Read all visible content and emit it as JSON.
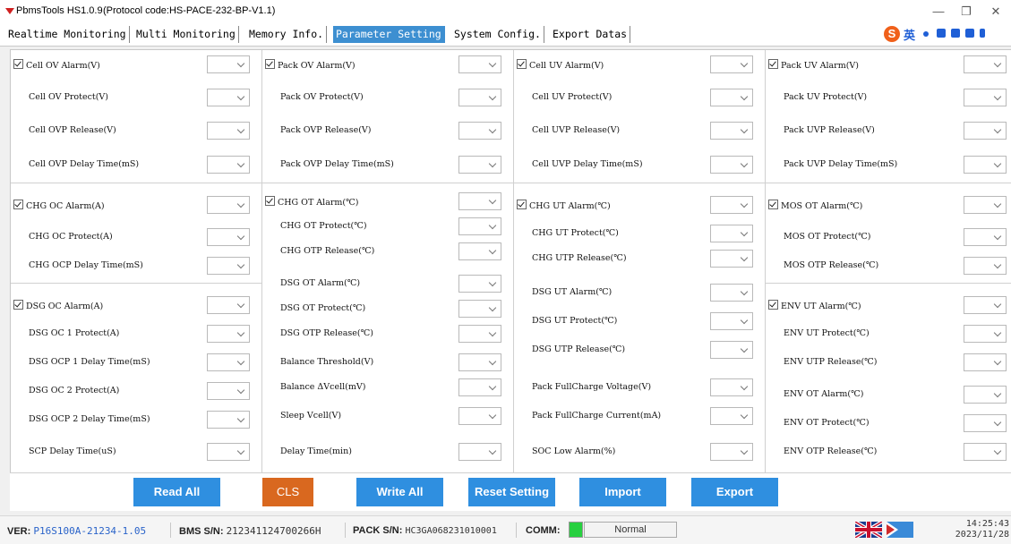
{
  "window": {
    "title": "PbmsTools HS1.0.9",
    "protocol": "(Protocol code:HS-PACE-232-BP-V1.1)"
  },
  "tabs": [
    {
      "label": "Realtime Monitoring",
      "active": false
    },
    {
      "label": "Multi Monitoring",
      "active": false
    },
    {
      "label": "Memory Info.",
      "active": false
    },
    {
      "label": "Parameter Setting",
      "active": true
    },
    {
      "label": "System Config.",
      "active": false
    },
    {
      "label": "Export Datas",
      "active": false
    }
  ],
  "ime": {
    "s_label": "S",
    "lang_label": "英"
  },
  "columns": [
    {
      "groups": [
        {
          "rows": [
            {
              "label": "Cell OV Alarm(V)",
              "checkbox": true
            },
            {
              "label": "Cell OV Protect(V)",
              "checkbox": false
            },
            {
              "label": "Cell OVP Release(V)",
              "checkbox": false
            },
            {
              "label": "Cell OVP Delay Time(mS)",
              "checkbox": false
            }
          ]
        },
        {
          "rows": [
            {
              "label": "CHG OC Alarm(A)",
              "checkbox": true
            },
            {
              "label": "CHG OC Protect(A)",
              "checkbox": false
            },
            {
              "label": "CHG OCP Delay Time(mS)",
              "checkbox": false
            }
          ]
        },
        {
          "rows": [
            {
              "label": "DSG OC Alarm(A)",
              "checkbox": true
            },
            {
              "label": "DSG OC 1 Protect(A)",
              "checkbox": false
            },
            {
              "label": "DSG OCP 1 Delay Time(mS)",
              "checkbox": false
            },
            {
              "label": "DSG OC 2 Protect(A)",
              "checkbox": false
            },
            {
              "label": "DSG OCP 2 Delay Time(mS)",
              "checkbox": false
            },
            {
              "label": "SCP Delay Time(uS)",
              "checkbox": false
            }
          ]
        }
      ]
    },
    {
      "groups": [
        {
          "rows": [
            {
              "label": "Pack OV Alarm(V)",
              "checkbox": true
            },
            {
              "label": "Pack OV Protect(V)",
              "checkbox": false
            },
            {
              "label": "Pack OVP Release(V)",
              "checkbox": false
            },
            {
              "label": "Pack OVP Delay Time(mS)",
              "checkbox": false
            }
          ]
        },
        {
          "rows": [
            {
              "label": "CHG OT Alarm(℃)",
              "checkbox": true
            },
            {
              "label": "CHG OT Protect(℃)",
              "checkbox": false
            },
            {
              "label": "CHG OTP Release(℃)",
              "checkbox": false
            },
            {
              "label": "DSG OT Alarm(℃)",
              "checkbox": false
            },
            {
              "label": "DSG OT Protect(℃)",
              "checkbox": false
            },
            {
              "label": "DSG OTP Release(℃)",
              "checkbox": false
            },
            {
              "label": "Balance Threshold(V)",
              "checkbox": false
            },
            {
              "label": "Balance ΔVcell(mV)",
              "checkbox": false
            },
            {
              "label": "Sleep Vcell(V)",
              "checkbox": false
            },
            {
              "label": "Delay Time(min)",
              "checkbox": false
            }
          ]
        }
      ]
    },
    {
      "groups": [
        {
          "rows": [
            {
              "label": "Cell UV Alarm(V)",
              "checkbox": true
            },
            {
              "label": "Cell UV Protect(V)",
              "checkbox": false
            },
            {
              "label": "Cell UVP Release(V)",
              "checkbox": false
            },
            {
              "label": "Cell UVP Delay Time(mS)",
              "checkbox": false
            }
          ]
        },
        {
          "rows": [
            {
              "label": "CHG UT Alarm(℃)",
              "checkbox": true
            },
            {
              "label": "CHG UT Protect(℃)",
              "checkbox": false
            },
            {
              "label": "CHG UTP Release(℃)",
              "checkbox": false
            },
            {
              "label": "DSG UT Alarm(℃)",
              "checkbox": false
            },
            {
              "label": "DSG UT Protect(℃)",
              "checkbox": false
            },
            {
              "label": "DSG UTP Release(℃)",
              "checkbox": false
            },
            {
              "label": "Pack FullCharge Voltage(V)",
              "checkbox": false
            },
            {
              "label": "Pack FullCharge Current(mA)",
              "checkbox": false
            },
            {
              "label": "SOC Low Alarm(%)",
              "checkbox": false
            }
          ]
        }
      ]
    },
    {
      "groups": [
        {
          "rows": [
            {
              "label": "Pack UV Alarm(V)",
              "checkbox": true
            },
            {
              "label": "Pack UV Protect(V)",
              "checkbox": false
            },
            {
              "label": "Pack UVP Release(V)",
              "checkbox": false
            },
            {
              "label": "Pack UVP Delay Time(mS)",
              "checkbox": false
            }
          ]
        },
        {
          "rows": [
            {
              "label": "MOS OT Alarm(℃)",
              "checkbox": true
            },
            {
              "label": "MOS OT Protect(℃)",
              "checkbox": false
            },
            {
              "label": "MOS OTP Release(℃)",
              "checkbox": false
            }
          ]
        },
        {
          "rows": [
            {
              "label": "ENV UT Alarm(℃)",
              "checkbox": true
            },
            {
              "label": "ENV UT Protect(℃)",
              "checkbox": false
            },
            {
              "label": "ENV UTP Release(℃)",
              "checkbox": false
            },
            {
              "label": "ENV OT Alarm(℃)",
              "checkbox": false
            },
            {
              "label": "ENV OT Protect(℃)",
              "checkbox": false
            },
            {
              "label": "ENV OTP Release(℃)",
              "checkbox": false
            }
          ]
        }
      ]
    }
  ],
  "buttons": {
    "read_all": "Read All",
    "cls": "CLS",
    "write_all": "Write All",
    "reset_setting": "Reset Setting",
    "import": "Import",
    "export": "Export"
  },
  "status": {
    "ver_label": "VER:",
    "ver_value": "P16S100A-21234-1.05",
    "bms_label": "BMS S/N:",
    "bms_value": "212341124700266H",
    "pack_label": "PACK S/N:",
    "pack_value": "HC3GA068231010001",
    "comm_label": "COMM:",
    "comm_value": "Normal",
    "time": "14:25:43",
    "date": "2023/11/28"
  },
  "colors": {
    "active_tab": "#3d8fd1",
    "button_blue": "#2f8fe0",
    "button_orange": "#d9681f",
    "comm_ok": "#28d040"
  }
}
